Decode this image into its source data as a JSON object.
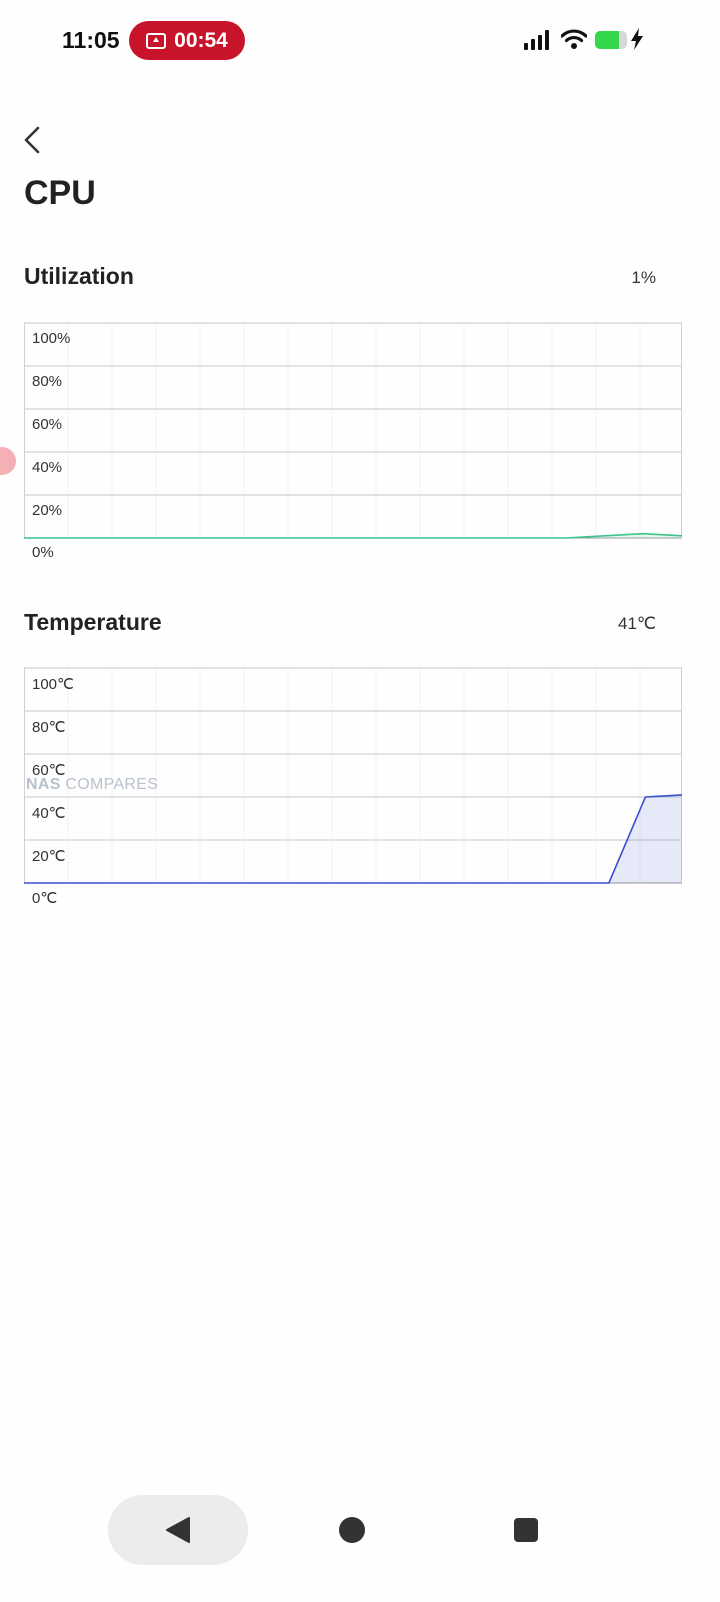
{
  "status_bar": {
    "time": "11:05",
    "recording_time": "00:54",
    "battery_level": 0.75,
    "icons": [
      "screen-record-icon",
      "signal-icon",
      "wifi-icon",
      "battery-icon",
      "charging-bolt-icon"
    ],
    "accent_color": "#c8142a",
    "battery_color": "#32d74b"
  },
  "header": {
    "title": "CPU",
    "back_icon": "chevron-left-icon"
  },
  "utilization": {
    "title": "Utilization",
    "value": "1%",
    "y_ticks": [
      "100%",
      "80%",
      "60%",
      "40%",
      "20%",
      "0%"
    ],
    "line_color": "#3cc48c"
  },
  "temperature": {
    "title": "Temperature",
    "value": "41℃",
    "y_ticks": [
      "100℃",
      "80℃",
      "60℃",
      "40℃",
      "20℃",
      "0℃"
    ],
    "line_color": "#3a4fd0"
  },
  "watermark": {
    "bold": "NAS",
    "rest": " COMPARES"
  },
  "chart_data": [
    {
      "type": "area",
      "ylim": [
        0,
        100
      ],
      "y_ticks": [
        0,
        20,
        40,
        60,
        80,
        100
      ],
      "grid": true,
      "series": [
        {
          "values": [
            0,
            0,
            0,
            0,
            0,
            0,
            0,
            0,
            0,
            0,
            0,
            0,
            0,
            0,
            0,
            1,
            2,
            1
          ]
        }
      ]
    },
    {
      "type": "area",
      "ylim": [
        0,
        100
      ],
      "y_ticks": [
        0,
        20,
        40,
        60,
        80,
        100
      ],
      "grid": true,
      "series": [
        {
          "values": [
            0,
            0,
            0,
            0,
            0,
            0,
            0,
            0,
            0,
            0,
            0,
            0,
            0,
            0,
            0,
            0,
            0,
            40,
            41
          ]
        }
      ]
    }
  ],
  "nav_bar": {
    "icons": [
      "back-triangle-icon",
      "home-circle-icon",
      "recents-square-icon"
    ]
  }
}
